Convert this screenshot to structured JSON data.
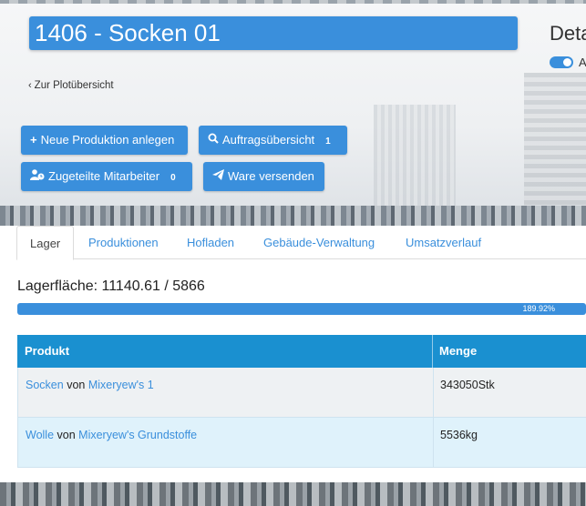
{
  "header": {
    "title": "1406 - Socken 01",
    "details_title": "Deta",
    "toggle_label": "A",
    "back_link": "Zur Plotübersicht"
  },
  "buttons": {
    "new_production": {
      "icon": "plus-icon",
      "label": "Neue Produktion anlegen"
    },
    "order_overview": {
      "icon": "search-icon",
      "label": "Auftragsübersicht",
      "badge": "1"
    },
    "assigned_staff": {
      "icon": "user-clock-icon",
      "label": "Zugeteilte Mitarbeiter",
      "badge": "0"
    },
    "ship_goods": {
      "icon": "paper-plane-icon",
      "label": "Ware versenden"
    }
  },
  "tabs": [
    "Lager",
    "Produktionen",
    "Hofladen",
    "Gebäude-Verwaltung",
    "Umsatzverlauf"
  ],
  "storage": {
    "label": "Lagerfläche: 11140.61 / 5866",
    "progress_text": "189.92%",
    "progress_value": 1.8992
  },
  "table": {
    "headers": [
      "Produkt",
      "Menge"
    ],
    "rows": [
      {
        "product": "Socken",
        "von": "von",
        "source": "Mixeryew's 1",
        "amount": "343050Stk"
      },
      {
        "product": "Wolle",
        "von": "von",
        "source": "Mixeryew's Grundstoffe",
        "amount": "5536kg"
      }
    ]
  },
  "colors": {
    "accent": "#3a8fdc",
    "table_header": "#1a90d0"
  }
}
